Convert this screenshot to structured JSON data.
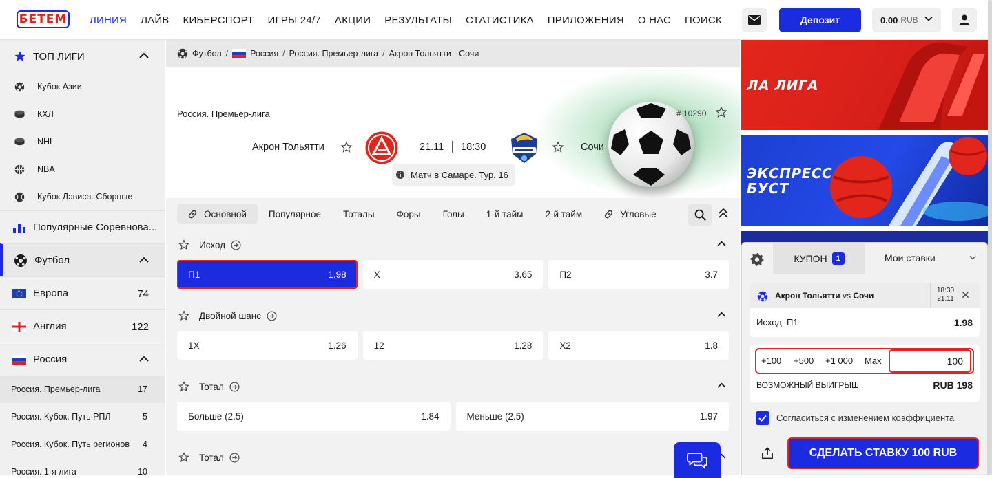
{
  "header": {
    "logo_text": "БЕТЕМ",
    "nav": [
      "ЛИНИЯ",
      "ЛАЙВ",
      "КИБЕРСПОРТ",
      "ИГРЫ 24/7",
      "АКЦИИ",
      "РЕЗУЛЬТАТЫ",
      "СТАТИСТИКА",
      "ПРИЛОЖЕНИЯ",
      "О НАС",
      "ПОИСК"
    ],
    "deposit_label": "Депозит",
    "balance_amount": "0.00",
    "balance_currency": "RUB",
    "accent_color": "#1a2be0",
    "alert_color": "#e0261e"
  },
  "sidebar": {
    "top_leagues_label": "ТОП ЛИГИ",
    "top_leagues": [
      "Кубок Азии",
      "КХЛ",
      "NHL",
      "NBA",
      "Кубок Дэвиса. Сборные"
    ],
    "popular_label": "Популярные Соревнова...",
    "football_label": "Футбол",
    "countries": [
      {
        "name": "Европа",
        "count": "74"
      },
      {
        "name": "Англия",
        "count": "122"
      },
      {
        "name": "Россия",
        "count": ""
      }
    ],
    "russia_leagues": [
      {
        "name": "Россия. Премьер-лига",
        "count": "17"
      },
      {
        "name": "Россия. Кубок. Путь РПЛ",
        "count": "5"
      },
      {
        "name": "Россия. Кубок. Путь регионов",
        "count": "4"
      },
      {
        "name": "Россия. 1-я лига",
        "count": "10"
      }
    ]
  },
  "breadcrumbs": [
    "Футбол",
    "Россия",
    "Россия. Премьер-лига",
    "Акрон Тольятти - Сочи"
  ],
  "match": {
    "league": "Россия. Премьер-лига",
    "id": "# 10290",
    "team1": "Акрон Тольятти",
    "team2": "Сочи",
    "date": "21.11",
    "time": "18:30",
    "venue": "Матч в Самаре. Тур. 16"
  },
  "tabs": [
    "Основной",
    "Популярное",
    "Тоталы",
    "Форы",
    "Голы",
    "1-й тайм",
    "2-й тайм",
    "Угловые"
  ],
  "markets": [
    {
      "title": "Исход",
      "odds": [
        {
          "label": "П1",
          "value": "1.98"
        },
        {
          "label": "Х",
          "value": "3.65"
        },
        {
          "label": "П2",
          "value": "3.7"
        }
      ]
    },
    {
      "title": "Двойной шанс",
      "odds": [
        {
          "label": "1Х",
          "value": "1.26"
        },
        {
          "label": "12",
          "value": "1.28"
        },
        {
          "label": "Х2",
          "value": "1.8"
        }
      ]
    },
    {
      "title": "Тотал",
      "odds": [
        {
          "label": "Больше (2.5)",
          "value": "1.84"
        },
        {
          "label": "Меньше (2.5)",
          "value": "1.97"
        }
      ]
    },
    {
      "title": "Тотал",
      "odds": []
    }
  ],
  "banners": [
    "ЛА ЛИГА",
    "ЭКСПРЕСС БУСТ"
  ],
  "coupon": {
    "tab1": "КУПОН",
    "count": "1",
    "tab2": "Мои ставки",
    "match": "Акрон Тольятти",
    "vs": "vs",
    "match2": "Сочи",
    "time": "18:30",
    "date": "21.11",
    "outcome": "Исход: П1",
    "odd": "1.98",
    "quick": [
      "+100",
      "+500",
      "+1 000",
      "Max"
    ],
    "stake": "100",
    "win_label": "ВОЗМОЖНЫЙ ВЫИГРЫШ",
    "win_value": "RUB 198",
    "agree_label": "Согласиться с изменением коэффициента",
    "submit_label": "СДЕЛАТЬ СТАВКУ 100 RUB"
  }
}
